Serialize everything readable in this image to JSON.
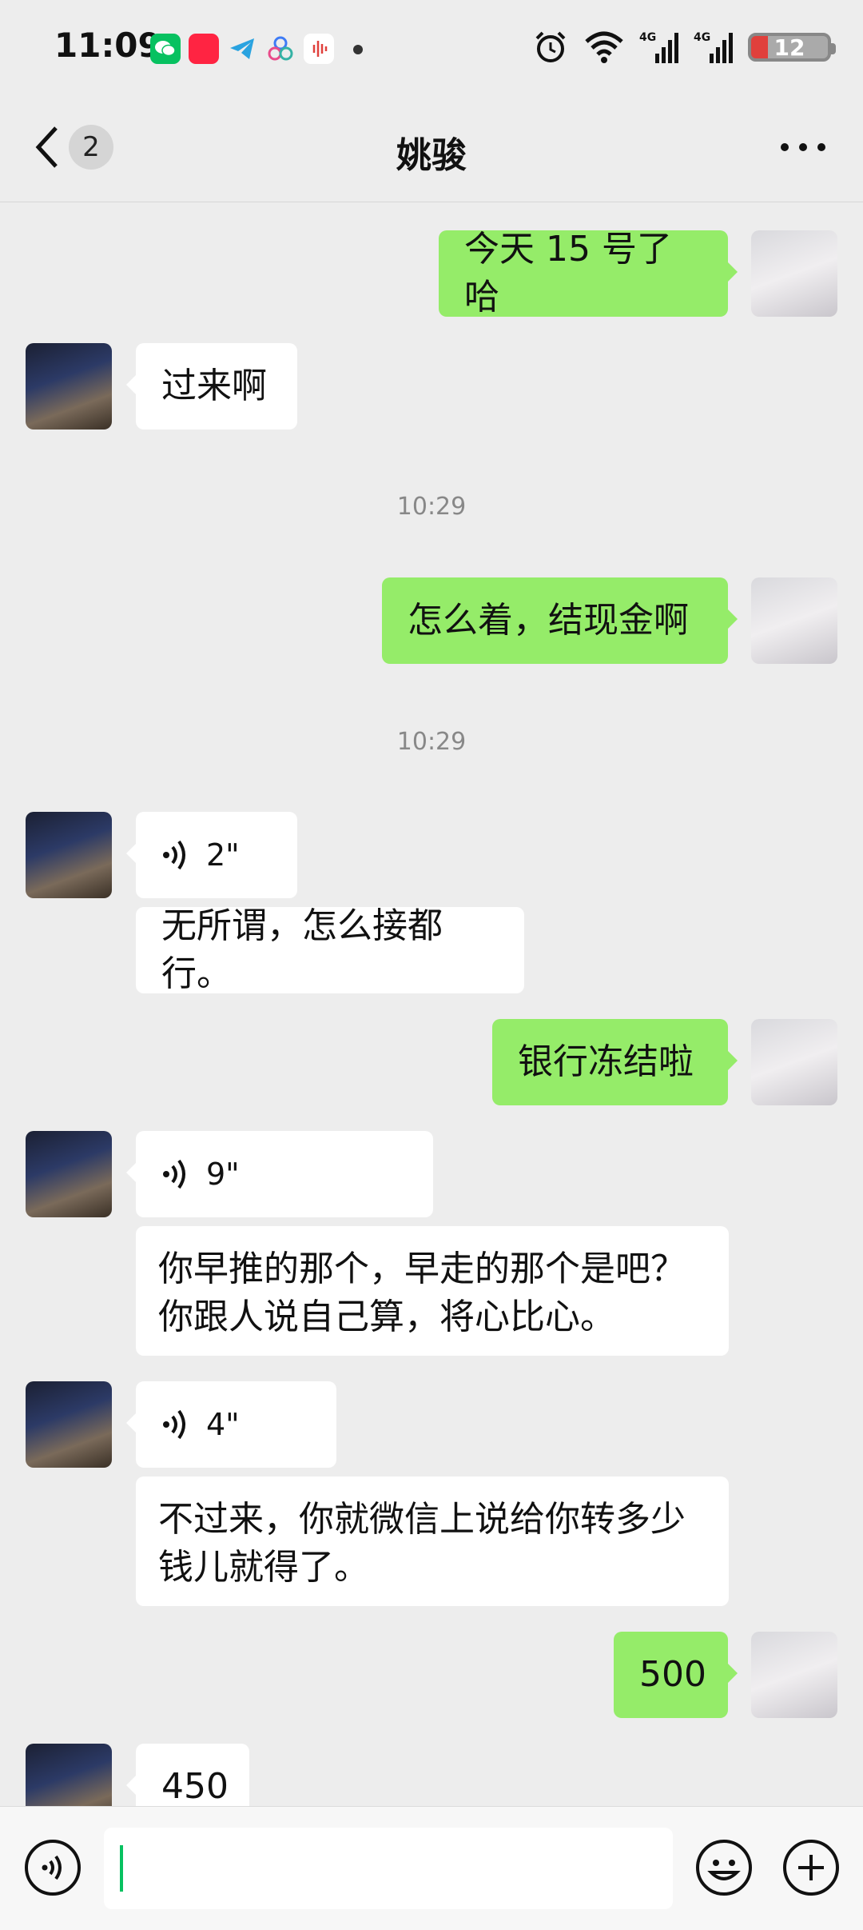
{
  "status_bar": {
    "time": "11:09",
    "app_icons": [
      "wechat-icon",
      "xiaohongshu-icon",
      "telegram-icon",
      "app-icon",
      "recorder-icon"
    ],
    "battery": "12"
  },
  "nav": {
    "back_count": "2",
    "title": "姚骏"
  },
  "messages": [
    {
      "side": "out",
      "text": "今天 15 号了哈"
    },
    {
      "side": "in",
      "text": "过来啊"
    },
    {
      "type": "timestamp",
      "text": "10:29"
    },
    {
      "side": "out",
      "text": "怎么着，结现金啊"
    },
    {
      "type": "timestamp",
      "text": "10:29"
    },
    {
      "side": "in",
      "type": "voice",
      "text": "2\""
    },
    {
      "side": "in",
      "text": "无所谓，怎么接都行。"
    },
    {
      "side": "out",
      "text": "银行冻结啦"
    },
    {
      "side": "in",
      "type": "voice",
      "text": "9\""
    },
    {
      "side": "in",
      "text": "你早推的那个，早走的那个是吧？你跟人说自己算，将心比心。"
    },
    {
      "side": "in",
      "type": "voice",
      "text": "4\""
    },
    {
      "side": "in",
      "text": "不过来，你就微信上说给你转多少钱儿就得了。"
    },
    {
      "side": "out",
      "text": "500"
    },
    {
      "side": "in",
      "text": "450"
    }
  ],
  "input": {
    "value": ""
  },
  "colors": {
    "outgoing_bubble": "#95EC69",
    "incoming_bubble": "#FFFFFF",
    "background": "#EDEDED",
    "caret": "#07C160"
  }
}
